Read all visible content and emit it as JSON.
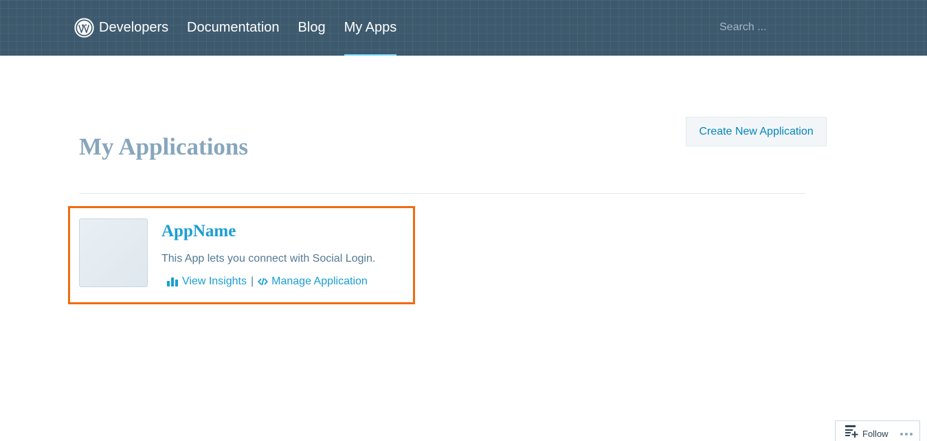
{
  "header": {
    "brand_label": "Developers",
    "nav": [
      {
        "label": "Documentation",
        "active": false
      },
      {
        "label": "Blog",
        "active": false
      },
      {
        "label": "My Apps",
        "active": true
      }
    ],
    "search_placeholder": "Search ..."
  },
  "main": {
    "title": "My Applications",
    "create_button_label": "Create New Application",
    "apps": [
      {
        "name": "AppName",
        "description": "This App lets you connect with Social Login.",
        "insights_label": "View Insights",
        "separator": "|",
        "manage_label": "Manage Application"
      }
    ]
  },
  "follow_widget": {
    "label": "Follow"
  },
  "colors": {
    "header_bg": "#3d596d",
    "accent": "#1b9ed2",
    "title": "#87a6bc",
    "highlight_border": "#f26b0f"
  }
}
